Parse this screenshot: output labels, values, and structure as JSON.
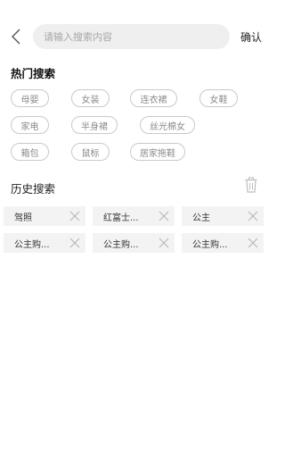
{
  "header": {
    "back_icon": "chevron-left-icon",
    "search_placeholder": "请输入搜索内容",
    "search_value": "",
    "confirm_label": "确认"
  },
  "hot": {
    "title": "热门搜索",
    "tags": [
      "母婴",
      "女装",
      "连衣裙",
      "女鞋",
      "家电",
      "半身裙",
      "丝光棉女",
      "箱包",
      "鼠标",
      "居家拖鞋"
    ]
  },
  "history": {
    "title": "历史搜索",
    "clear_icon": "trash-icon",
    "items": [
      "驾照",
      "红富士...",
      "公主",
      "公主购...",
      "公主购...",
      "公主购..."
    ],
    "remove_icon": "close-icon"
  },
  "colors": {
    "chip_border": "#c9c9c9",
    "chip_text": "#8a8a8a",
    "history_bg": "#f3f3f3",
    "search_bg": "#efefef"
  }
}
